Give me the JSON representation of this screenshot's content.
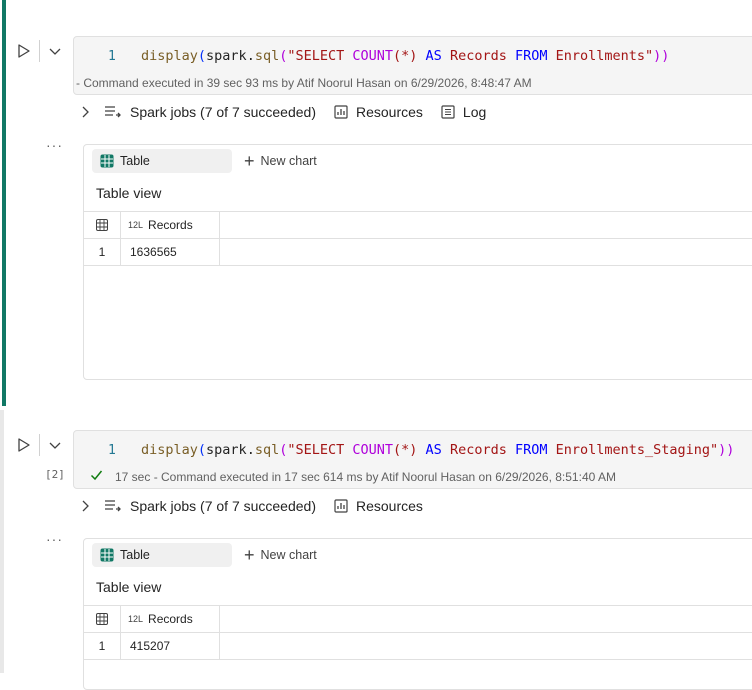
{
  "cells": [
    {
      "exec_count": "",
      "line_number": "1",
      "code": {
        "func": "display",
        "open": "(",
        "obj": "spark",
        "dot": ".",
        "method": "sql",
        "open2": "(",
        "sql_a": "\"SELECT ",
        "sql_fn": "COUNT",
        "sql_b": "(*) ",
        "sql_as": "AS",
        "sql_c": " Records ",
        "sql_from": "FROM",
        "sql_d": " Enrollments\"",
        "close": "))"
      },
      "status": "- Command executed in 39 sec 93 ms by Atif Noorul Hasan on 6/29/2026, 8:48:47 AM",
      "toolbar": {
        "spark_jobs": "Spark jobs (7 of 7 succeeded)",
        "resources": "Resources",
        "log": "Log"
      },
      "output": {
        "tab_table": "Table",
        "tab_new_chart": "New chart",
        "table_view": "Table view",
        "column_type": "12L",
        "column": "Records",
        "rows": [
          {
            "index": "1",
            "value": "1636565"
          }
        ]
      }
    },
    {
      "exec_count": "[2]",
      "line_number": "1",
      "code": {
        "func": "display",
        "open": "(",
        "obj": "spark",
        "dot": ".",
        "method": "sql",
        "open2": "(",
        "sql_a": "\"SELECT ",
        "sql_fn": "COUNT",
        "sql_b": "(*) ",
        "sql_as": "AS",
        "sql_c": " Records ",
        "sql_from": "FROM",
        "sql_d": " Enrollments_Staging\"",
        "close": "))"
      },
      "status": "17 sec - Command executed in 17 sec 614 ms by Atif Noorul Hasan on 6/29/2026, 8:51:40 AM",
      "toolbar": {
        "spark_jobs": "Spark jobs (7 of 7 succeeded)",
        "resources": "Resources"
      },
      "output": {
        "tab_table": "Table",
        "tab_new_chart": "New chart",
        "table_view": "Table view",
        "column_type": "12L",
        "column": "Records",
        "rows": [
          {
            "index": "1",
            "value": "415207"
          }
        ]
      }
    }
  ],
  "colors": {
    "active_cell_bar": "#117865",
    "success_check": "#107c10",
    "table_icon": "#117865"
  }
}
